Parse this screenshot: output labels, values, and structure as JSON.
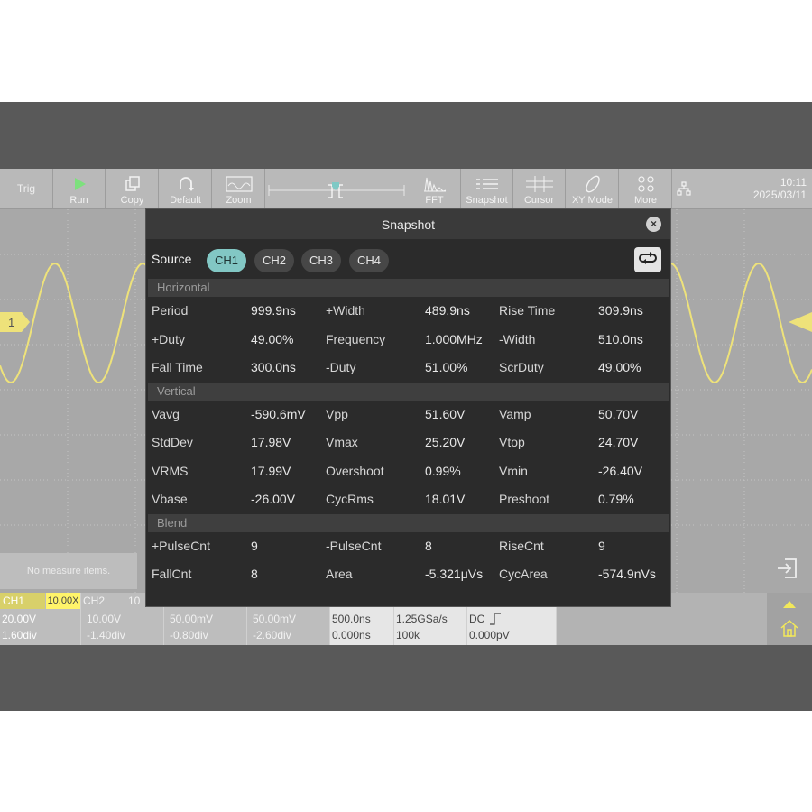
{
  "toolbar": {
    "trig": "Trig",
    "buttons": [
      "Run",
      "Copy",
      "Default",
      "Zoom",
      "FFT",
      "Snapshot",
      "Cursor",
      "XY Mode",
      "More"
    ],
    "time": "10:11",
    "date": "2025/03/11"
  },
  "markers": {
    "ch1": "1"
  },
  "left_panel": {
    "no_measure": "No measure items."
  },
  "bottom": {
    "ch1": {
      "label": "CH1",
      "probe": "10.00X",
      "scale": "20.00V",
      "offset": "1.60div"
    },
    "ch2": {
      "label": "CH2",
      "probe": "10",
      "scale": "10.00V",
      "offset": "-1.40div"
    },
    "ch3": {
      "scale": "50.00mV",
      "offset": "-0.80div"
    },
    "ch4": {
      "scale": "50.00mV",
      "offset": "-2.60div"
    },
    "timebase": {
      "scale": "500.0ns",
      "delay": "0.000ns"
    },
    "acq": {
      "rate": "1.25GSa/s",
      "depth": "100k"
    },
    "trigger": {
      "coupling": "DC",
      "level": "0.000pV"
    }
  },
  "snapshot": {
    "title": "Snapshot",
    "close": "×",
    "source_label": "Source",
    "channels": [
      "CH1",
      "CH2",
      "CH3",
      "CH4"
    ],
    "active_channel": "CH1",
    "sections": [
      {
        "name": "Horizontal",
        "rows": [
          [
            "Period",
            "999.9ns",
            "+Width",
            "489.9ns",
            "Rise Time",
            "309.9ns"
          ],
          [
            "+Duty",
            "49.00%",
            "Frequency",
            "1.000MHz",
            "-Width",
            "510.0ns"
          ],
          [
            "Fall Time",
            "300.0ns",
            "-Duty",
            "51.00%",
            "ScrDuty",
            "49.00%"
          ]
        ]
      },
      {
        "name": "Vertical",
        "rows": [
          [
            "Vavg",
            "-590.6mV",
            "Vpp",
            "51.60V",
            "Vamp",
            "50.70V"
          ],
          [
            "StdDev",
            "17.98V",
            "Vmax",
            "25.20V",
            "Vtop",
            "24.70V"
          ],
          [
            "VRMS",
            "17.99V",
            "Overshoot",
            "0.99%",
            "Vmin",
            "-26.40V"
          ],
          [
            "Vbase",
            "-26.00V",
            "CycRms",
            "18.01V",
            "Preshoot",
            "0.79%"
          ]
        ]
      },
      {
        "name": "Blend",
        "rows": [
          [
            "+PulseCnt",
            "9",
            "-PulseCnt",
            "8",
            "RiseCnt",
            "9"
          ],
          [
            "FallCnt",
            "8",
            "Area",
            "-5.321μVs",
            "CycArea",
            "-574.9nVs"
          ]
        ]
      }
    ]
  },
  "colors": {
    "ch1": "#f2e85a",
    "accent": "#82c7c4",
    "dialog_bg": "#2b2b2b"
  }
}
